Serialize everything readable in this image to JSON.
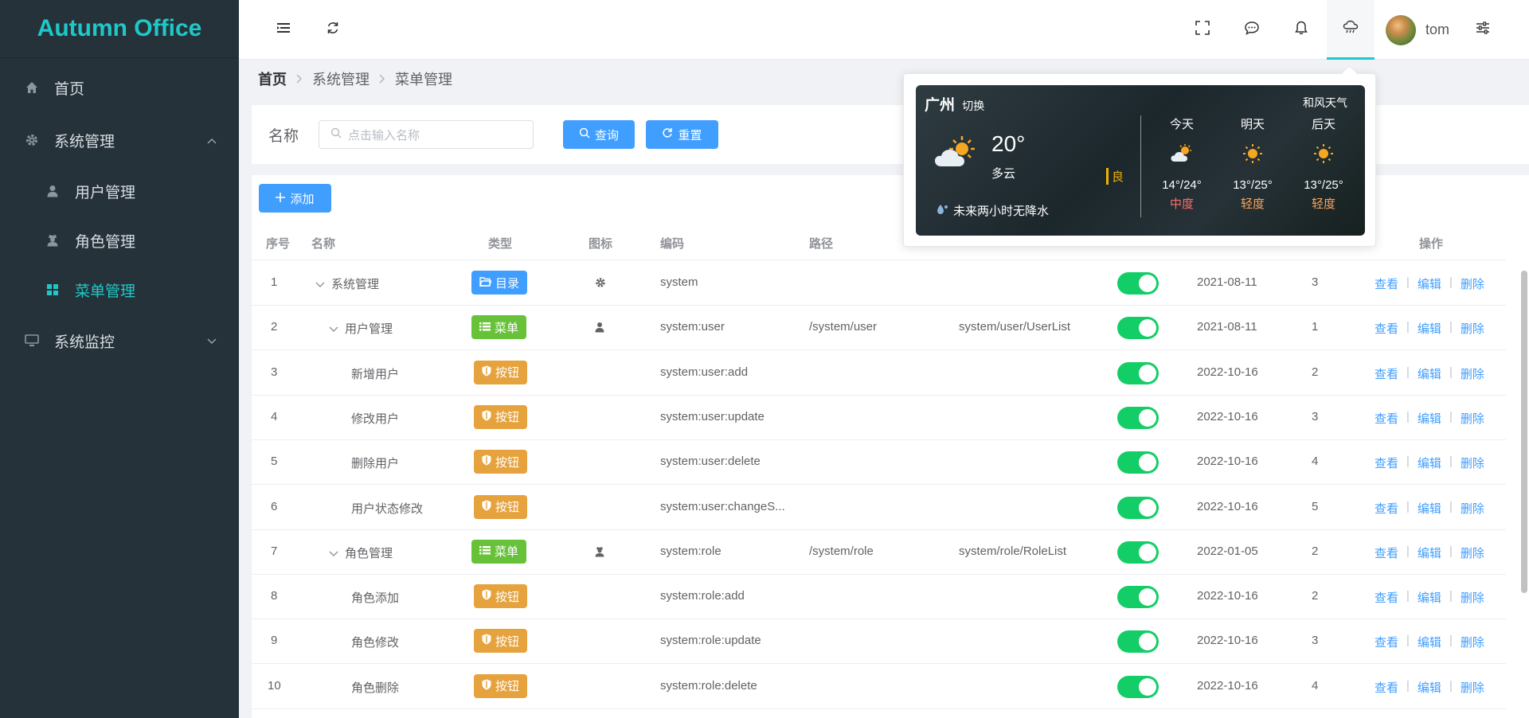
{
  "app": {
    "title": "Autumn Office"
  },
  "sidebar": {
    "items": [
      {
        "label": "首页"
      },
      {
        "label": "系统管理"
      },
      {
        "label": "用户管理"
      },
      {
        "label": "角色管理"
      },
      {
        "label": "菜单管理"
      },
      {
        "label": "系统监控"
      }
    ]
  },
  "header": {
    "username": "tom"
  },
  "breadcrumb": [
    "首页",
    "系统管理",
    "菜单管理"
  ],
  "search": {
    "label": "名称",
    "placeholder": "点击输入名称",
    "query_label": "查询",
    "reset_label": "重置"
  },
  "toolbar": {
    "add_label": "添加"
  },
  "table": {
    "headers": [
      "序号",
      "名称",
      "类型",
      "图标",
      "编码",
      "路径",
      "操作"
    ],
    "actions": [
      "查看",
      "编辑",
      "删除"
    ],
    "separator": "|",
    "rows": [
      {
        "no": "1",
        "name": "系统管理",
        "type": "目录",
        "code": "system",
        "path": "",
        "component": "",
        "date": "2021-08-11",
        "sort": "3"
      },
      {
        "no": "2",
        "name": "用户管理",
        "type": "菜单",
        "code": "system:user",
        "path": "/system/user",
        "component": "system/user/UserList",
        "date": "2021-08-11",
        "sort": "1"
      },
      {
        "no": "3",
        "name": "新增用户",
        "type": "按钮",
        "code": "system:user:add",
        "path": "",
        "component": "",
        "date": "2022-10-16",
        "sort": "2"
      },
      {
        "no": "4",
        "name": "修改用户",
        "type": "按钮",
        "code": "system:user:update",
        "path": "",
        "component": "",
        "date": "2022-10-16",
        "sort": "3"
      },
      {
        "no": "5",
        "name": "删除用户",
        "type": "按钮",
        "code": "system:user:delete",
        "path": "",
        "component": "",
        "date": "2022-10-16",
        "sort": "4"
      },
      {
        "no": "6",
        "name": "用户状态修改",
        "type": "按钮",
        "code": "system:user:changeS...",
        "path": "",
        "component": "",
        "date": "2022-10-16",
        "sort": "5"
      },
      {
        "no": "7",
        "name": "角色管理",
        "type": "菜单",
        "code": "system:role",
        "path": "/system/role",
        "component": "system/role/RoleList",
        "date": "2022-01-05",
        "sort": "2"
      },
      {
        "no": "8",
        "name": "角色添加",
        "type": "按钮",
        "code": "system:role:add",
        "path": "",
        "component": "",
        "date": "2022-10-16",
        "sort": "2"
      },
      {
        "no": "9",
        "name": "角色修改",
        "type": "按钮",
        "code": "system:role:update",
        "path": "",
        "component": "",
        "date": "2022-10-16",
        "sort": "3"
      },
      {
        "no": "10",
        "name": "角色删除",
        "type": "按钮",
        "code": "system:role:delete",
        "path": "",
        "component": "",
        "date": "2022-10-16",
        "sort": "4"
      }
    ]
  },
  "weather": {
    "city": "广州",
    "switch_label": "切换",
    "brand": "和风天气",
    "temp": "20°",
    "desc": "多云",
    "aqi": "良",
    "rain": "未来两小时无降水",
    "forecast": [
      {
        "day": "今天",
        "temp": "14°/24°",
        "aqi": "中度",
        "aqi_color": "#ff6b6b",
        "icon": "partly-cloudy-icon"
      },
      {
        "day": "明天",
        "temp": "13°/25°",
        "aqi": "轻度",
        "aqi_color": "#f7a35c",
        "icon": "sun-icon"
      },
      {
        "day": "后天",
        "temp": "13°/25°",
        "aqi": "轻度",
        "aqi_color": "#f7a35c",
        "icon": "sun-icon"
      }
    ]
  },
  "colors": {
    "accent": "#1fc8c8",
    "primary": "#409eff",
    "success": "#67c23a",
    "warning": "#e6a23c",
    "switch_on": "#13ce66",
    "sidebar_bg": "#26323a"
  }
}
